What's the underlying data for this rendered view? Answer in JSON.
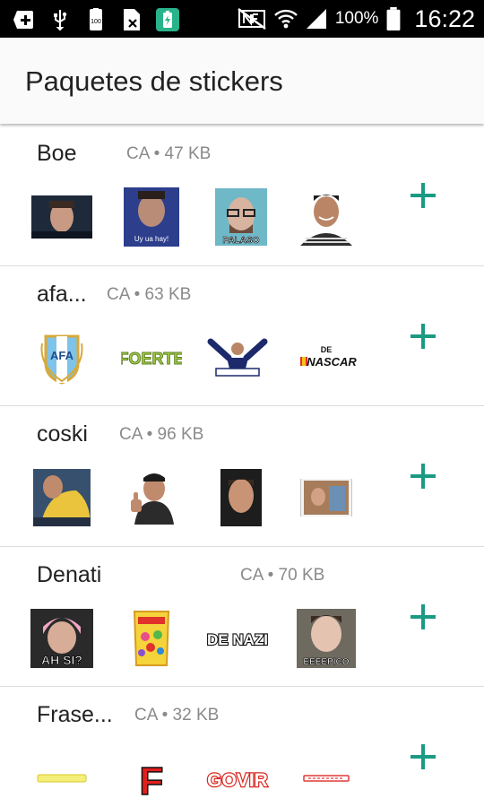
{
  "status_bar": {
    "battery_percent": "100%",
    "time": "16:22",
    "left_icons": [
      "add-box-icon",
      "usb-icon",
      "battery-full-small-icon",
      "sim-off-icon",
      "battery-charging-app-icon"
    ],
    "right_icons": [
      "nfc-off-icon",
      "wifi-icon",
      "cell-signal-icon",
      "battery-icon"
    ]
  },
  "app_bar": {
    "title": "Paquetes de stickers"
  },
  "accent_color": "#1b9a83",
  "packs": [
    {
      "name": "Boe",
      "meta": "CA • 47 KB",
      "stickers": [
        {
          "icon": "sticker-face-dark",
          "caption": ""
        },
        {
          "icon": "sticker-face-blue",
          "caption": "Uy ua hay!"
        },
        {
          "icon": "sticker-face-glasses",
          "caption": "PALASO"
        },
        {
          "icon": "sticker-face-smile",
          "caption": ""
        }
      ]
    },
    {
      "name": "afa...",
      "meta": "CA • 63 KB",
      "stickers": [
        {
          "icon": "sticker-afa-crest",
          "caption": "AFA"
        },
        {
          "icon": "sticker-text-green",
          "caption": "FOERTE"
        },
        {
          "icon": "sticker-player-arms",
          "caption": ""
        },
        {
          "icon": "sticker-nascar",
          "caption": "NASCAR"
        }
      ]
    },
    {
      "name": "coski",
      "meta": "CA • 96 KB",
      "stickers": [
        {
          "icon": "sticker-yellow-shirt",
          "caption": ""
        },
        {
          "icon": "sticker-thumbs-up",
          "caption": ""
        },
        {
          "icon": "sticker-face-portrait",
          "caption": ""
        },
        {
          "icon": "sticker-meme-photo",
          "caption": ""
        }
      ]
    },
    {
      "name": "Denati",
      "meta": "CA • 70 KB",
      "stickers": [
        {
          "icon": "sticker-pink-hair",
          "caption": "AH SI?"
        },
        {
          "icon": "sticker-candy-bag",
          "caption": ""
        },
        {
          "icon": "sticker-text-bw",
          "caption": "DE NAZI"
        },
        {
          "icon": "sticker-face-eeepico",
          "caption": "EEEEPICO"
        }
      ]
    },
    {
      "name": "Frase...",
      "meta": "CA • 32 KB",
      "stickers": [
        {
          "icon": "sticker-yellow-text",
          "caption": ""
        },
        {
          "icon": "sticker-red-f",
          "caption": "F"
        },
        {
          "icon": "sticker-red-text",
          "caption": "GOVIR"
        },
        {
          "icon": "sticker-small-red-text",
          "caption": ""
        }
      ]
    }
  ]
}
